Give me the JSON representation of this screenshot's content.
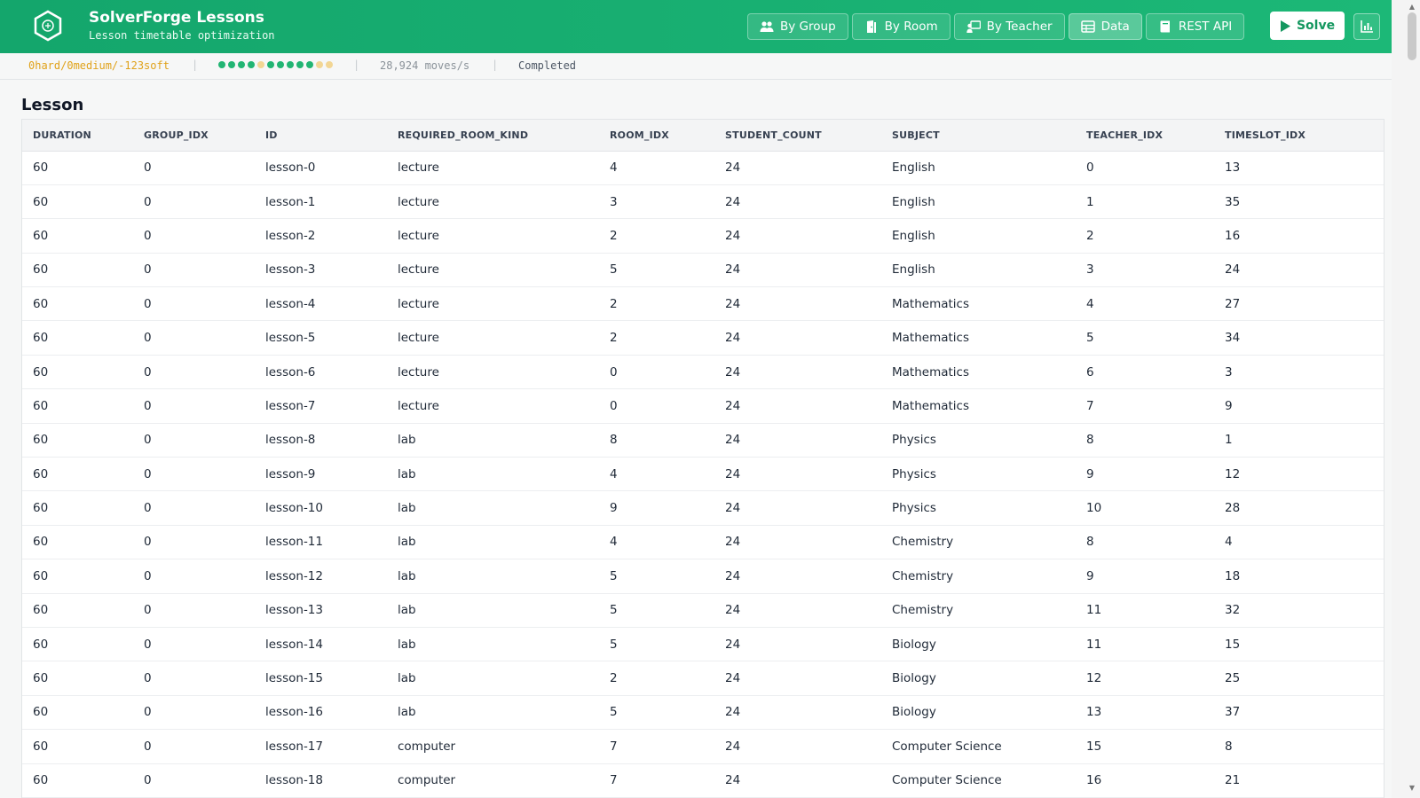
{
  "header": {
    "title": "SolverForge Lessons",
    "subtitle": "Lesson timetable optimization",
    "nav": [
      {
        "label": "By Group",
        "icon": "users-icon"
      },
      {
        "label": "By Room",
        "icon": "door-icon"
      },
      {
        "label": "By Teacher",
        "icon": "teacher-icon"
      },
      {
        "label": "Data",
        "icon": "table-icon",
        "active": true
      },
      {
        "label": "REST API",
        "icon": "book-icon"
      }
    ],
    "solve_label": "Solve"
  },
  "status": {
    "score": "0hard/0medium/-123soft",
    "moves_rate": "28,924 moves/s",
    "state": "Completed",
    "dot_colors": [
      "#22b573",
      "#22b573",
      "#22b573",
      "#22b573",
      "#f2d694",
      "#22b573",
      "#22b573",
      "#22b573",
      "#22b573",
      "#22b573",
      "#f2d694",
      "#f2d694"
    ]
  },
  "section": {
    "title": "Lesson"
  },
  "table": {
    "columns": [
      "DURATION",
      "GROUP_IDX",
      "ID",
      "REQUIRED_ROOM_KIND",
      "ROOM_IDX",
      "STUDENT_COUNT",
      "SUBJECT",
      "TEACHER_IDX",
      "TIMESLOT_IDX"
    ],
    "rows": [
      [
        "60",
        "0",
        "lesson-0",
        "lecture",
        "4",
        "24",
        "English",
        "0",
        "13"
      ],
      [
        "60",
        "0",
        "lesson-1",
        "lecture",
        "3",
        "24",
        "English",
        "1",
        "35"
      ],
      [
        "60",
        "0",
        "lesson-2",
        "lecture",
        "2",
        "24",
        "English",
        "2",
        "16"
      ],
      [
        "60",
        "0",
        "lesson-3",
        "lecture",
        "5",
        "24",
        "English",
        "3",
        "24"
      ],
      [
        "60",
        "0",
        "lesson-4",
        "lecture",
        "2",
        "24",
        "Mathematics",
        "4",
        "27"
      ],
      [
        "60",
        "0",
        "lesson-5",
        "lecture",
        "2",
        "24",
        "Mathematics",
        "5",
        "34"
      ],
      [
        "60",
        "0",
        "lesson-6",
        "lecture",
        "0",
        "24",
        "Mathematics",
        "6",
        "3"
      ],
      [
        "60",
        "0",
        "lesson-7",
        "lecture",
        "0",
        "24",
        "Mathematics",
        "7",
        "9"
      ],
      [
        "60",
        "0",
        "lesson-8",
        "lab",
        "8",
        "24",
        "Physics",
        "8",
        "1"
      ],
      [
        "60",
        "0",
        "lesson-9",
        "lab",
        "4",
        "24",
        "Physics",
        "9",
        "12"
      ],
      [
        "60",
        "0",
        "lesson-10",
        "lab",
        "9",
        "24",
        "Physics",
        "10",
        "28"
      ],
      [
        "60",
        "0",
        "lesson-11",
        "lab",
        "4",
        "24",
        "Chemistry",
        "8",
        "4"
      ],
      [
        "60",
        "0",
        "lesson-12",
        "lab",
        "5",
        "24",
        "Chemistry",
        "9",
        "18"
      ],
      [
        "60",
        "0",
        "lesson-13",
        "lab",
        "5",
        "24",
        "Chemistry",
        "11",
        "32"
      ],
      [
        "60",
        "0",
        "lesson-14",
        "lab",
        "5",
        "24",
        "Biology",
        "11",
        "15"
      ],
      [
        "60",
        "0",
        "lesson-15",
        "lab",
        "2",
        "24",
        "Biology",
        "12",
        "25"
      ],
      [
        "60",
        "0",
        "lesson-16",
        "lab",
        "5",
        "24",
        "Biology",
        "13",
        "37"
      ],
      [
        "60",
        "0",
        "lesson-17",
        "computer",
        "7",
        "24",
        "Computer Science",
        "15",
        "8"
      ],
      [
        "60",
        "0",
        "lesson-18",
        "computer",
        "7",
        "24",
        "Computer Science",
        "16",
        "21"
      ]
    ]
  }
}
